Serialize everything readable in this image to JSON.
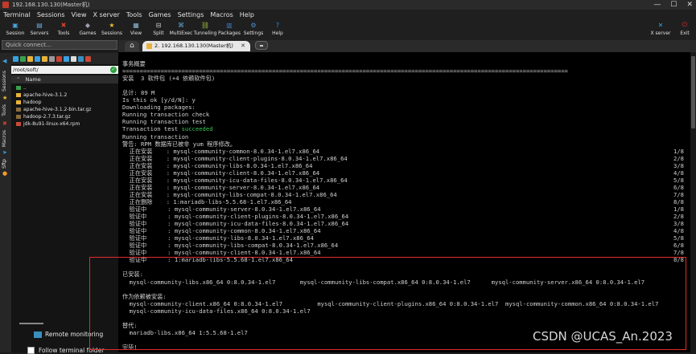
{
  "window": {
    "title": "192.168.130.130(Master机)",
    "controls": [
      "—",
      "☐",
      "✕"
    ]
  },
  "menu": [
    "Terminal",
    "Sessions",
    "View",
    "X server",
    "Tools",
    "Games",
    "Settings",
    "Macros",
    "Help"
  ],
  "toolbar": [
    {
      "label": "Session",
      "icon": "session-icon",
      "color": "#4aa3df"
    },
    {
      "label": "Servers",
      "icon": "servers-icon",
      "color": "#6aa9d8"
    },
    {
      "label": "Tools",
      "icon": "tools-icon",
      "color": "#d04030"
    },
    {
      "label": "Games",
      "icon": "games-icon",
      "color": "#9aa0a8"
    },
    {
      "label": "Sessions",
      "icon": "star-icon",
      "color": "#f2c12e"
    },
    {
      "label": "View",
      "icon": "view-icon",
      "color": "#8fb8d8"
    },
    {
      "label": "Split",
      "icon": "split-icon",
      "color": "#d0d0d0"
    },
    {
      "label": "MultiExec",
      "icon": "multiexec-icon",
      "color": "#5aa0d0"
    },
    {
      "label": "Tunneling",
      "icon": "tunneling-icon",
      "color": "#a0c040"
    },
    {
      "label": "Packages",
      "icon": "packages-icon",
      "color": "#3f7fc0"
    },
    {
      "label": "Settings",
      "icon": "gear-icon",
      "color": "#4a8fd0"
    },
    {
      "label": "Help",
      "icon": "help-icon",
      "color": "#2f8fe0"
    }
  ],
  "toolbar_right": [
    {
      "label": "X server",
      "icon": "xserver-icon",
      "color": "#3aa0d0"
    },
    {
      "label": "Exit",
      "icon": "power-icon",
      "color": "#e03030"
    }
  ],
  "quick_connect": {
    "placeholder": "Quick connect..."
  },
  "vertical_tabs": [
    "Sessions",
    "Tools",
    "Macros",
    "Sftp"
  ],
  "sidebar": {
    "path": "/root/soft/",
    "column_header": "Name",
    "files": [
      {
        "name": "..",
        "type": "up"
      },
      {
        "name": "apache-hive-3.1.2",
        "type": "folder"
      },
      {
        "name": "hadoop",
        "type": "folder"
      },
      {
        "name": "apache-hive-3.1.2-bin.tar.gz",
        "type": "archive"
      },
      {
        "name": "hadoop-2.7.3.tar.gz",
        "type": "archive"
      },
      {
        "name": "jdk-8u91-linux-x64.rpm",
        "type": "rpm"
      }
    ],
    "remote_monitoring": "Remote monitoring",
    "follow_terminal": "Follow terminal folder"
  },
  "tabs": {
    "home": "⌂",
    "session": "2. 192.168.130.130(Master机)"
  },
  "terminal": {
    "lines": [
      "事务概要",
      "================================================================================================================================",
      "安装  3 软件包 (+4 依赖软件包)",
      "",
      "总计: 89 M",
      "Is this ok [y/d/N]: y",
      "Downloading packages:",
      "Running transaction check",
      "Running transaction test",
      "Transaction test succeeded",
      "Running transaction",
      "警告: RPM 数据库已被非 yum 程序修改。",
      "  正在安装    : mysql-community-common-8.0.34-1.el7.x86_64",
      "  正在安装    : mysql-community-client-plugins-8.0.34-1.el7.x86_64",
      "  正在安装    : mysql-community-libs-8.0.34-1.el7.x86_64",
      "  正在安装    : mysql-community-client-8.0.34-1.el7.x86_64",
      "  正在安装    : mysql-community-icu-data-files-8.0.34-1.el7.x86_64",
      "  正在安装    : mysql-community-server-8.0.34-1.el7.x86_64",
      "  正在安装    : mysql-community-libs-compat-8.0.34-1.el7.x86_64",
      "  正在删除    : 1:mariadb-libs-5.5.68-1.el7.x86_64",
      "  验证中      : mysql-community-server-8.0.34-1.el7.x86_64",
      "  验证中      : mysql-community-client-plugins-8.0.34-1.el7.x86_64",
      "  验证中      : mysql-community-icu-data-files-8.0.34-1.el7.x86_64",
      "  验证中      : mysql-community-common-8.0.34-1.el7.x86_64",
      "  验证中      : mysql-community-libs-8.0.34-1.el7.x86_64",
      "  验证中      : mysql-community-libs-compat-8.0.34-1.el7.x86_64",
      "  验证中      : mysql-community-client-8.0.34-1.el7.x86_64",
      "  验证中      : 1:mariadb-libs-5.5.68-1.el7.x86_64",
      "",
      "已安装:",
      "  mysql-community-libs.x86_64 0:8.0.34-1.el7       mysql-community-libs-compat.x86_64 0:8.0.34-1.el7      mysql-community-server.x86_64 0:8.0.34-1.el7",
      "",
      "作为依赖被安装:",
      "  mysql-community-client.x86_64 0:8.0.34-1.el7          mysql-community-client-plugins.x86_64 0:8.0.34-1.el7  mysql-community-common.x86_64 0:8.0.34-1.el7",
      "  mysql-community-icu-data-files.x86_64 0:8.0.34-1.el7",
      "",
      "替代:",
      "  mariadb-libs.x86_64 1:5.5.68-1.el7",
      "",
      "完毕!"
    ],
    "counters": [
      "1/8",
      "2/8",
      "3/8",
      "4/8",
      "5/8",
      "6/8",
      "7/8",
      "8/8",
      "1/8",
      "2/8",
      "3/8",
      "4/8",
      "5/8",
      "6/8",
      "7/8",
      "8/8"
    ],
    "green_word": "succeeded"
  },
  "watermark": "CSDN @UCAS_An.2023",
  "colors": {
    "highlight_box": "#e52c2c",
    "success_text": "#39c85a"
  }
}
